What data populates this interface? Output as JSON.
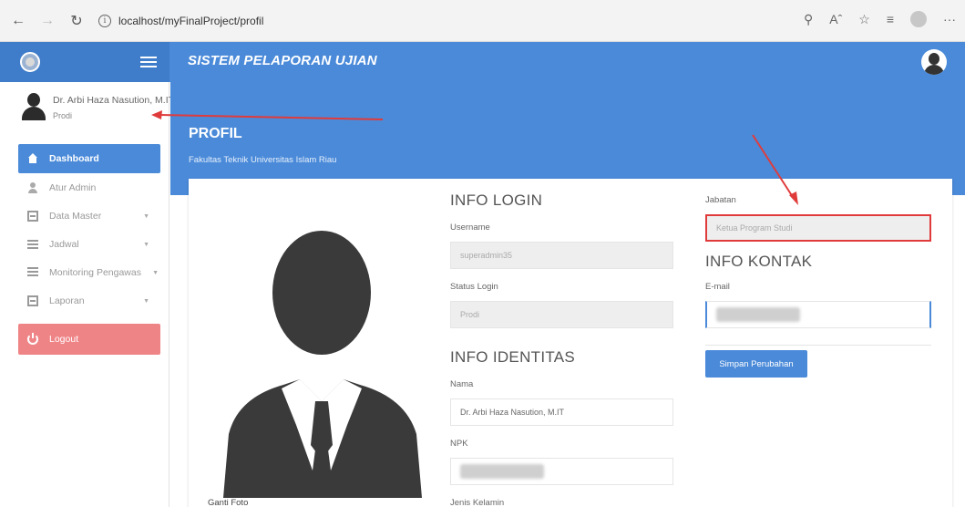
{
  "browser": {
    "url": "localhost/myFinalProject/profil"
  },
  "header": {
    "app_title": "SISTEM PELAPORAN UJIAN"
  },
  "sidebar": {
    "user_name": "Dr. Arbi Haza Nasution, M.IT",
    "user_role": "Prodi",
    "items": [
      {
        "label": "Dashboard",
        "icon": "home-icon"
      },
      {
        "label": "Atur Admin",
        "icon": "user-icon"
      },
      {
        "label": "Data Master",
        "icon": "database-icon"
      },
      {
        "label": "Jadwal",
        "icon": "list-icon"
      },
      {
        "label": "Monitoring Pengawas",
        "icon": "grid-icon"
      },
      {
        "label": "Laporan",
        "icon": "report-icon"
      }
    ],
    "logout_label": "Logout"
  },
  "page": {
    "title": "PROFIL",
    "subtitle": "Fakultas Teknik Universitas Islam Riau",
    "photo_label": "Ganti Foto"
  },
  "login": {
    "section_title": "INFO LOGIN",
    "username_label": "Username",
    "username_value": "superadmin35",
    "status_label": "Status Login",
    "status_value": "Prodi"
  },
  "identity": {
    "section_title": "INFO IDENTITAS",
    "name_label": "Nama",
    "name_value": "Dr. Arbi Haza Nasution, M.IT",
    "npk_label": "NPK",
    "gender_label": "Jenis Kelamin"
  },
  "position": {
    "label": "Jabatan",
    "value": "Ketua Program Studi"
  },
  "contact": {
    "section_title": "INFO KONTAK",
    "email_label": "E-mail"
  },
  "save_label": "Simpan Perubahan",
  "colors": {
    "primary": "#4a8ad9",
    "logout": "#ef8487",
    "annotation": "#e03b3b"
  }
}
